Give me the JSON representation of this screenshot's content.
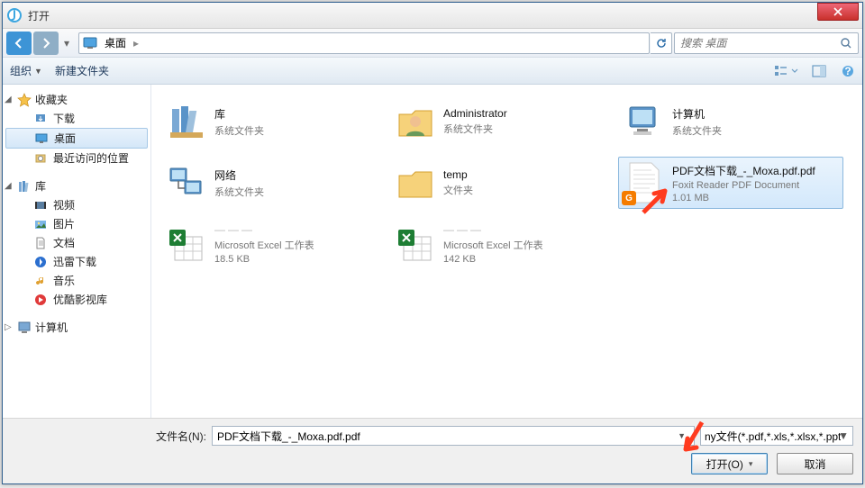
{
  "window": {
    "title": "打开"
  },
  "nav": {
    "breadcrumb_root": "桌面",
    "search_placeholder": "搜索 桌面"
  },
  "toolbar": {
    "organize": "组织",
    "new_folder": "新建文件夹"
  },
  "sidebar": {
    "favorites": {
      "label": "收藏夹",
      "items": [
        {
          "label": "下载",
          "icon": "download"
        },
        {
          "label": "桌面",
          "icon": "desktop",
          "selected": true
        },
        {
          "label": "最近访问的位置",
          "icon": "recent"
        }
      ]
    },
    "libraries": {
      "label": "库",
      "items": [
        {
          "label": "视频",
          "icon": "video"
        },
        {
          "label": "图片",
          "icon": "pictures"
        },
        {
          "label": "文档",
          "icon": "documents"
        },
        {
          "label": "迅雷下载",
          "icon": "xunlei"
        },
        {
          "label": "音乐",
          "icon": "music"
        },
        {
          "label": "优酷影视库",
          "icon": "youku"
        }
      ]
    },
    "computer": {
      "label": "计算机"
    }
  },
  "files": [
    {
      "name": "库",
      "sub1": "系统文件夹",
      "sub2": "",
      "icon": "libraries"
    },
    {
      "name": "Administrator",
      "sub1": "系统文件夹",
      "sub2": "",
      "icon": "user"
    },
    {
      "name": "计算机",
      "sub1": "系统文件夹",
      "sub2": "",
      "icon": "computer"
    },
    {
      "name": "网络",
      "sub1": "系统文件夹",
      "sub2": "",
      "icon": "network"
    },
    {
      "name": "temp",
      "sub1": "文件夹",
      "sub2": "",
      "icon": "folder"
    },
    {
      "name": "PDF文档下载_-_Moxa.pdf.pdf",
      "sub1": "Foxit Reader PDF Document",
      "sub2": "1.01 MB",
      "icon": "pdf",
      "selected": true
    },
    {
      "name": "———",
      "sub1": "Microsoft Excel 工作表",
      "sub2": "18.5 KB",
      "icon": "xlsx",
      "blurred": true
    },
    {
      "name": "———",
      "sub1": "Microsoft Excel 工作表",
      "sub2": "142 KB",
      "icon": "xlsx",
      "blurred": true
    }
  ],
  "footer": {
    "filename_label": "文件名(N):",
    "filename_value": "PDF文档下载_-_Moxa.pdf.pdf",
    "filter_text": "ny文件(*.pdf,*.xls,*.xlsx,*.ppt",
    "open": "打开(O)",
    "cancel": "取消"
  }
}
